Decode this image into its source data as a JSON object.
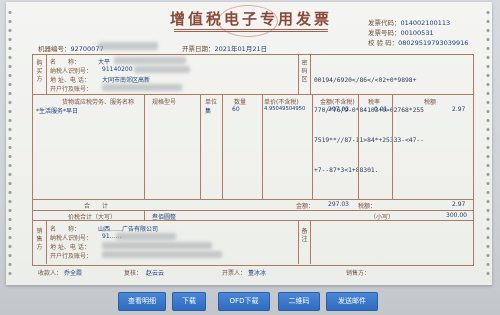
{
  "invoice": {
    "title": "增值税电子专用发票",
    "code_label": "发票代码：",
    "code_value": "014002100113",
    "number_label": "发票号码：",
    "number_value": "00100531",
    "check_label": "校 验 码：",
    "check_value": "08029519793039916",
    "machine_label": "机器编号：",
    "machine_value": "92700077",
    "date_label": "开票日期：",
    "date_value": "2021年01月21日"
  },
  "buyer": {
    "section_label": "购买方",
    "name_label": "名　　称：",
    "name_value": "大平",
    "tax_label": "纳税人识别号：",
    "tax_value": "91140200",
    "addr_label": "地 址、电 话：",
    "addr_value": "大同市南郊区高新",
    "bank_label": "开户行及账号："
  },
  "cipher": {
    "section_label": "密码区",
    "lines": [
      "00194/6920</86</<02+0*9898+",
      "770/*76/9-0*84103+0>02768*255",
      "7519**//87-11>84*+25333-<47--",
      "+7--87*3<1+88301."
    ]
  },
  "items": {
    "header_name": "货物或应税劳务、服务名称",
    "header_spec": "规格型号",
    "header_unit": "单位",
    "header_qty": "数量",
    "header_price": "单价(不含税)",
    "header_amount": "金额(不含税)",
    "header_rate": "税率",
    "header_tax": "税额",
    "rows": [
      {
        "name": "*生活服务*早日",
        "unit": "集",
        "qty": "60",
        "price": "4.95049504950",
        "amount": "297.03",
        "rate": "0.01",
        "tax": "2.97"
      }
    ]
  },
  "totals": {
    "label": "合　　计",
    "amount": "297.03",
    "tax": "2.97",
    "amount_sym": "金额：",
    "tax_sym": "税额：",
    "caps_label": "价税合计（大写）",
    "caps_value": "叁佰圆整",
    "small_label": "（小写）",
    "small_value": "300.00"
  },
  "seller": {
    "section_label": "销售方",
    "name_label": "名　　称：",
    "name_value": "山西……广告有限公司",
    "tax_label": "纳税人识别号：",
    "tax_value": "91……",
    "addr_label": "地 址、电 话：",
    "bank_label": "开户行及账号：",
    "remark_label": "备注"
  },
  "footer": {
    "payee_label": "收款人：",
    "payee_value": "乔全霞",
    "reviewer_label": "复核：",
    "reviewer_value": "赵云云",
    "issuer_label": "开票人：",
    "issuer_value": "董冰冰",
    "seller_stamp_label": "销售方："
  },
  "buttons": {
    "view": "查看明细",
    "download": "下载",
    "ofd": "OFD下载",
    "qr": "二维码",
    "email": "发送邮件"
  }
}
